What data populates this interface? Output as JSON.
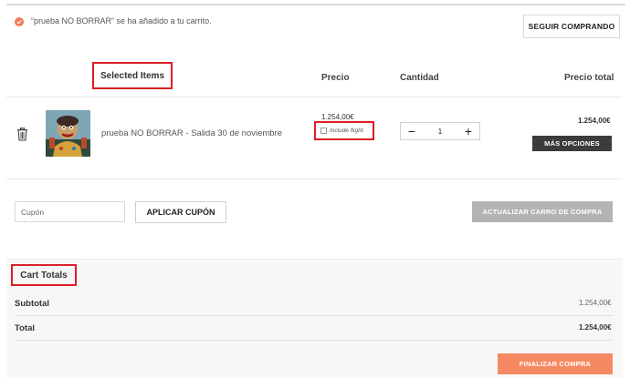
{
  "notice": {
    "message": "“prueba NO BORRAR” se ha añadido a tu carrito.",
    "continue_label": "SEGUIR COMPRANDO",
    "icon": "check-circle-icon"
  },
  "table": {
    "headers": {
      "items": "Selected Items",
      "price": "Precio",
      "quantity": "Cantidad",
      "total": "Precio total"
    },
    "items": [
      {
        "name": "prueba NO BORRAR - Salida 30 de noviembre",
        "price": "1.254,00€",
        "flight_label": "Include flight.",
        "flight_checked": false,
        "quantity": "1",
        "decrement": "−",
        "increment": "+",
        "total": "1.254,00€",
        "more_options_label": "MÁS OPCIONES"
      }
    ]
  },
  "coupon": {
    "placeholder": "Cupón",
    "apply_label": "APLICAR CUPÓN",
    "update_label": "ACTUALIZAR CARRO DE COMPRA"
  },
  "totals": {
    "title": "Cart Totals",
    "subtotal_label": "Subtotal",
    "subtotal_value": "1.254,00€",
    "total_label": "Total",
    "total_value": "1.254,00€",
    "checkout_label": "FINALIZAR COMPRA"
  },
  "colors": {
    "accent": "#f2795a",
    "highlight_box": "#d91f26",
    "dark_button": "#3c3c3c",
    "disabled_button": "#b3b3b3",
    "checkout_button": "#f58a62"
  }
}
